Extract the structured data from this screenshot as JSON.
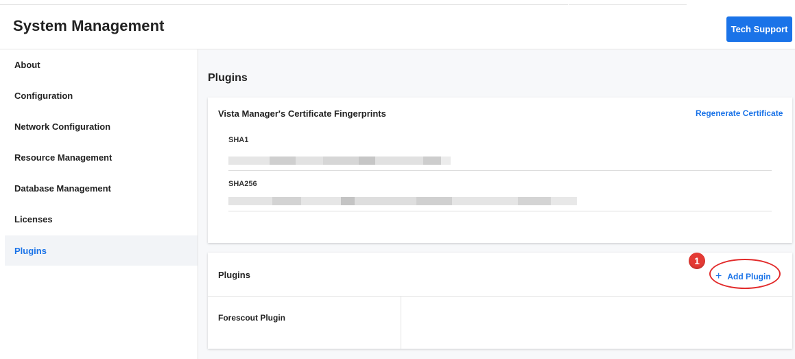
{
  "header": {
    "title": "System Management",
    "tech_support_label": "Tech Support"
  },
  "sidebar": {
    "items": [
      {
        "label": "About"
      },
      {
        "label": "Configuration"
      },
      {
        "label": "Network Configuration"
      },
      {
        "label": "Resource Management"
      },
      {
        "label": "Database Management"
      },
      {
        "label": "Licenses"
      },
      {
        "label": "Plugins",
        "active": true
      }
    ]
  },
  "main": {
    "heading": "Plugins",
    "cert_card": {
      "title": "Vista Manager's Certificate Fingerprints",
      "regenerate_label": "Regenerate Certificate",
      "fingerprints": [
        {
          "label": "SHA1"
        },
        {
          "label": "SHA256"
        }
      ]
    },
    "plugins_card": {
      "title": "Plugins",
      "add_label": "Add Plugin",
      "add_icon": "plus-icon",
      "plugins": [
        {
          "name": "Forescout Plugin"
        }
      ]
    }
  },
  "annotation": {
    "callout_number": "1",
    "callout_color": "#e22b2b"
  },
  "colors": {
    "accent": "#1a73e8",
    "active_bg": "#f2f4f7"
  }
}
